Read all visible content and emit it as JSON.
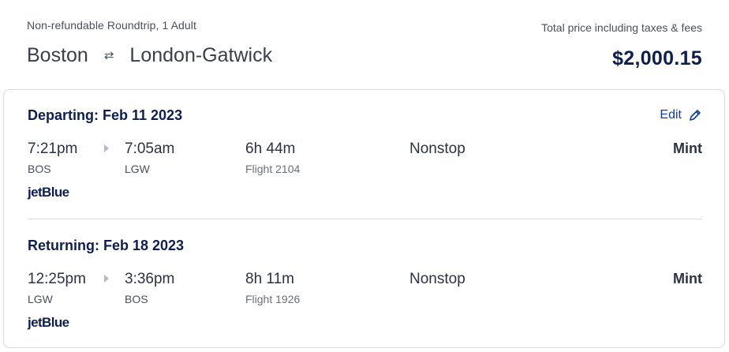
{
  "summary": {
    "trip_type": "Non-refundable Roundtrip, 1 Adult",
    "origin": "Boston",
    "swap_icon": "⇄",
    "destination": "London-Gatwick",
    "price_label": "Total price including taxes & fees",
    "price": "$2,000.15"
  },
  "legs": [
    {
      "title": "Departing: Feb 11 2023",
      "depart_time": "7:21pm",
      "depart_code": "BOS",
      "arrive_time": "7:05am",
      "arrive_code": "LGW",
      "duration": "6h 44m",
      "flight": "Flight 2104",
      "stops": "Nonstop",
      "cabin": "Mint",
      "airline": "jetBlue",
      "edit_label": "Edit"
    },
    {
      "title": "Returning: Feb 18 2023",
      "depart_time": "12:25pm",
      "depart_code": "LGW",
      "arrive_time": "3:36pm",
      "arrive_code": "BOS",
      "duration": "8h 11m",
      "flight": "Flight 1926",
      "stops": "Nonstop",
      "cabin": "Mint",
      "airline": "jetBlue"
    }
  ],
  "colors": {
    "navy": "#0d1f4f",
    "link": "#0e3f9a",
    "border": "#d9dbe0"
  },
  "icons": {
    "edit": "pencil-icon",
    "swap": "swap-arrows-icon",
    "leg_arrow": "chevron-right-icon"
  }
}
